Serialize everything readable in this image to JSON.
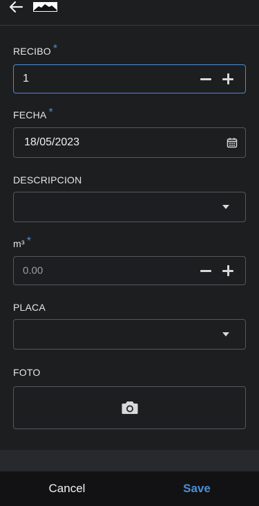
{
  "header": {
    "back_icon": "arrow-left-icon",
    "logo": "company-logo"
  },
  "form": {
    "recibo": {
      "label": "RECIBO",
      "required_mark": "*",
      "value": "1",
      "decrement_icon": "minus-icon",
      "increment_icon": "plus-icon"
    },
    "fecha": {
      "label": "FECHA",
      "required_mark": "*",
      "value": "18/05/2023",
      "icon": "calendar-icon"
    },
    "descripcion": {
      "label": "DESCRIPCION",
      "value": "",
      "icon": "dropdown-caret-icon"
    },
    "m3": {
      "label": "m³",
      "required_mark": "*",
      "placeholder": "0.00",
      "decrement_icon": "minus-icon",
      "increment_icon": "plus-icon"
    },
    "placa": {
      "label": "PLACA",
      "value": "",
      "icon": "dropdown-caret-icon"
    },
    "foto": {
      "label": "FOTO",
      "icon": "camera-icon"
    }
  },
  "footer": {
    "cancel_label": "Cancel",
    "save_label": "Save"
  },
  "colors": {
    "background": "#1d1e20",
    "accent": "#4a8fd6",
    "field_border": "#56585c",
    "bottom_bar": "#121214"
  }
}
